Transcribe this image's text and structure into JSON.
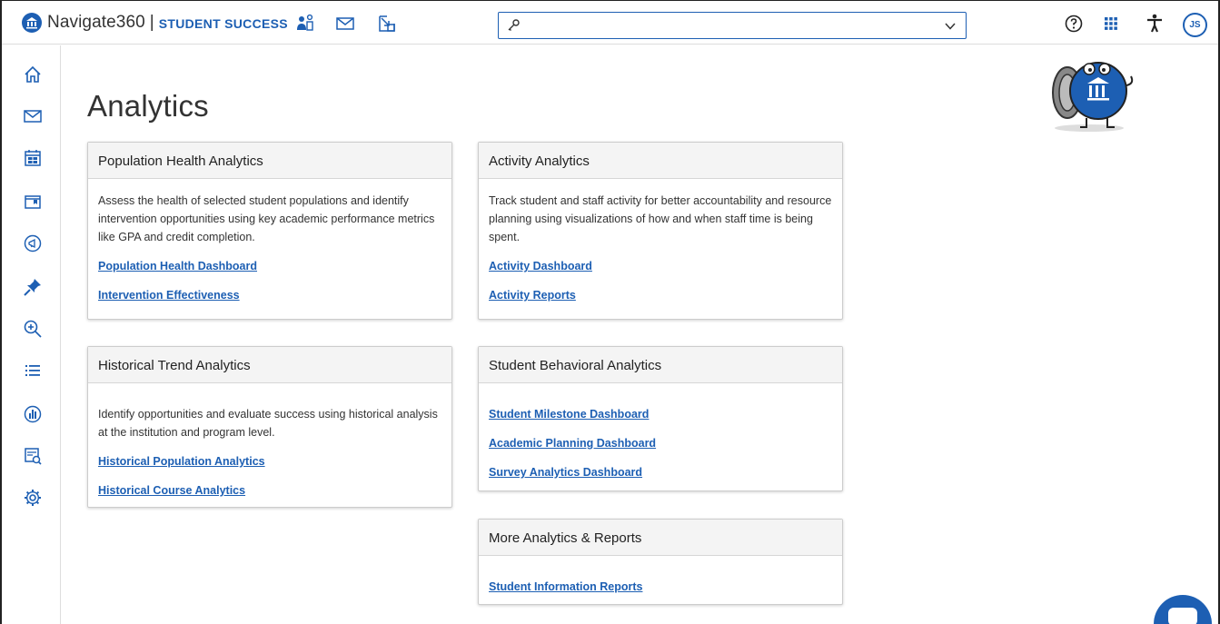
{
  "header": {
    "brand_name": "Navigate360",
    "brand_sep": "|",
    "brand_sub": "STUDENT SUCCESS",
    "search_placeholder": "",
    "avatar_initials": "JS"
  },
  "page": {
    "title": "Analytics"
  },
  "cards": {
    "population": {
      "title": "Population Health Analytics",
      "description": "Assess the health of selected student populations and identify intervention opportunities using key academic performance metrics like GPA and credit completion.",
      "links": [
        "Population Health Dashboard",
        "Intervention Effectiveness"
      ]
    },
    "activity": {
      "title": "Activity Analytics",
      "description": "Track student and staff activity for better accountability and resource planning using visualizations of how and when staff time is being spent.",
      "links": [
        "Activity Dashboard",
        "Activity Reports"
      ]
    },
    "historical": {
      "title": "Historical Trend Analytics",
      "description": "Identify opportunities and evaluate success using historical analysis at the institution and program level.",
      "links": [
        "Historical Population Analytics",
        "Historical Course Analytics"
      ]
    },
    "behavioral": {
      "title": "Student Behavioral Analytics",
      "links": [
        "Student Milestone Dashboard",
        "Academic Planning Dashboard",
        "Survey Analytics Dashboard"
      ]
    },
    "more": {
      "title": "More Analytics & Reports",
      "links": [
        "Student Information Reports"
      ]
    }
  },
  "colors": {
    "brand_blue": "#1d5fb3",
    "card_header_bg": "#f4f4f4"
  },
  "icons": {
    "header": [
      "institution-logo-icon",
      "students-icon",
      "mail-icon",
      "launch-icon",
      "key-icon",
      "chevron-down-icon",
      "help-icon",
      "apps-grid-icon",
      "accessibility-icon"
    ],
    "sidebar": [
      "home-icon",
      "mail-icon",
      "calendar-icon",
      "folder-icon",
      "campaign-icon",
      "pin-icon",
      "zoom-search-icon",
      "list-icon",
      "analytics-icon",
      "report-search-icon",
      "settings-icon"
    ]
  }
}
